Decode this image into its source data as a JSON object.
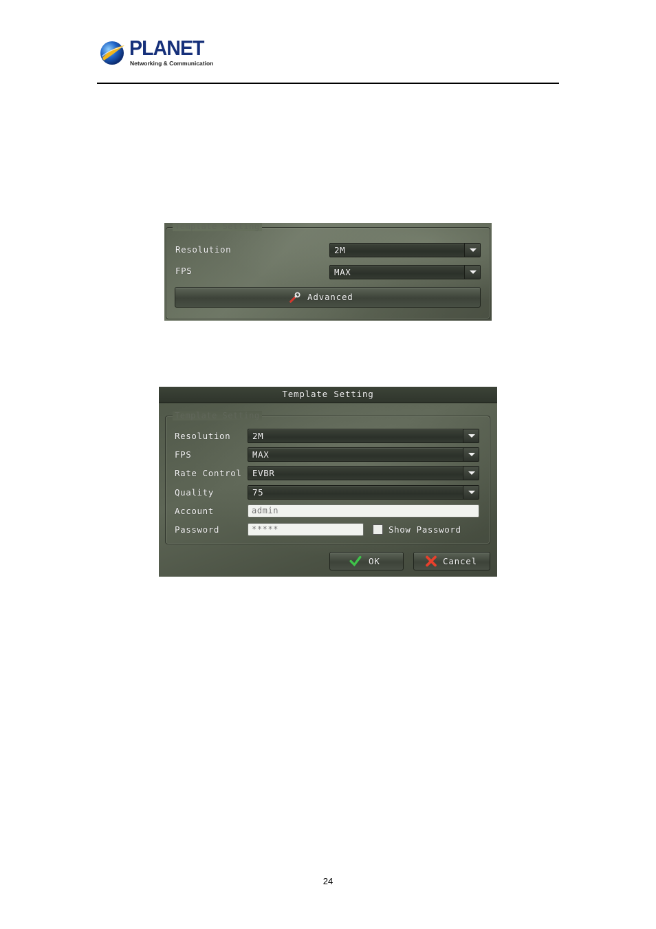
{
  "header": {
    "logo_text": "PLANET",
    "logo_tagline": "Networking & Communication"
  },
  "shot1": {
    "group_title": "Template Setting",
    "rows": [
      {
        "label": "Resolution",
        "value": "2M"
      },
      {
        "label": "FPS",
        "value": "MAX"
      }
    ],
    "advanced_label": "Advanced",
    "icons": {
      "advanced": "wrench-icon"
    }
  },
  "shot2": {
    "window_title": "Template Setting",
    "group_title": "Template Setting",
    "rows": [
      {
        "label": "Resolution",
        "value": "2M"
      },
      {
        "label": "FPS",
        "value": "MAX"
      },
      {
        "label": "Rate Control",
        "value": "EVBR"
      },
      {
        "label": "Quality",
        "value": "75"
      }
    ],
    "account": {
      "label": "Account",
      "value": "admin"
    },
    "password": {
      "label": "Password",
      "value": "*****"
    },
    "show_password_label": "Show Password",
    "show_password_checked": false,
    "ok_label": "OK",
    "cancel_label": "Cancel",
    "icons": {
      "ok": "checkmark-icon",
      "cancel": "cross-icon"
    }
  },
  "footer": {
    "page_number": "24"
  },
  "colors": {
    "brand_blue": "#16307a",
    "ok_green": "#3fc24a",
    "cancel_red": "#e8402c"
  }
}
